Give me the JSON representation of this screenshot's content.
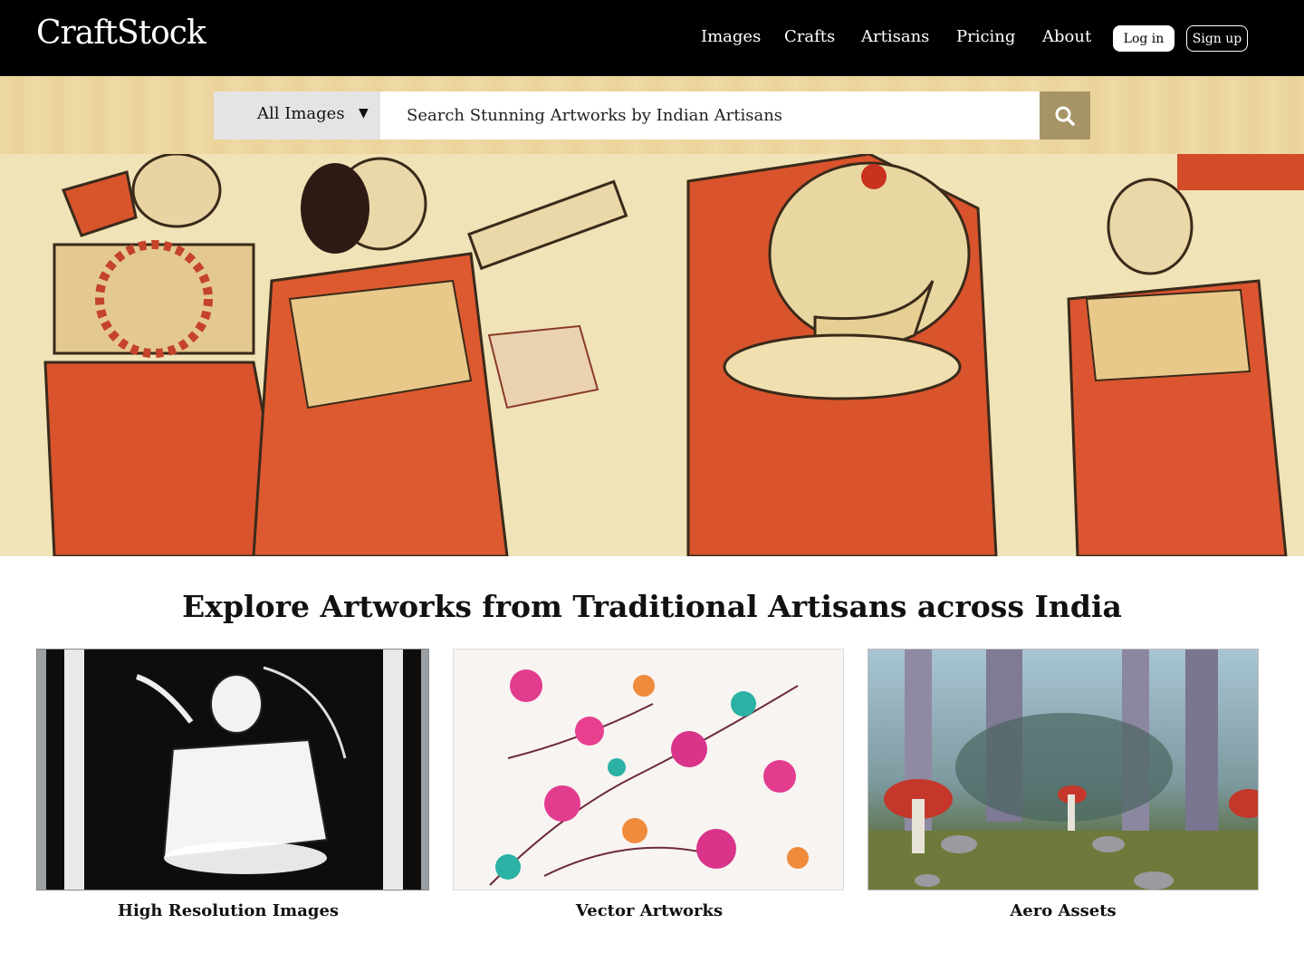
{
  "header": {
    "logo": "CraftStock",
    "nav": [
      "Images",
      "Crafts",
      "Artisans",
      "Pricing",
      "About"
    ],
    "login_label": "Log in",
    "signup_label": "Sign up"
  },
  "search": {
    "category": "All Images",
    "placeholder": "Search Stunning Artworks by Indian Artisans",
    "icon": "search-icon"
  },
  "hero": {
    "description_icon": "painting-image"
  },
  "main": {
    "title": "Explore Artworks from Traditional Artisans across India",
    "cards": [
      {
        "label": "High Resolution Images"
      },
      {
        "label": "Vector Artworks"
      },
      {
        "label": "Aero Assets"
      }
    ]
  },
  "colors": {
    "header_bg": "#000000",
    "search_button": "#a69466",
    "select_bg": "#e4e4e4"
  }
}
